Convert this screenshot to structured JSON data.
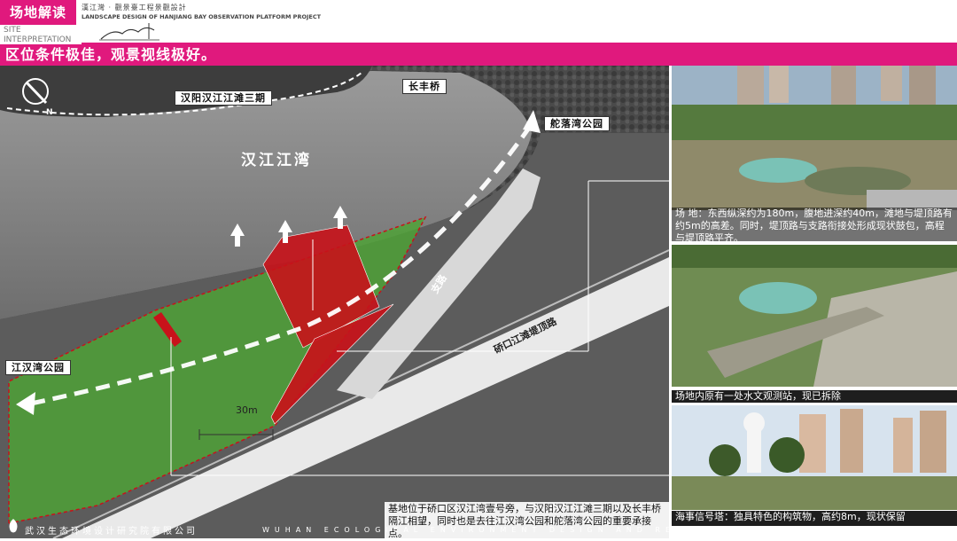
{
  "header": {
    "badge": "场地解读",
    "badge_sub": "SITE\nINTERPRETATION",
    "project_cn": "漢江灣 · 觀景臺工程景觀設計",
    "project_en": "LANDSCAPE DESIGN OF HANJIANG BAY OBSERVATION PLATFORM PROJECT"
  },
  "title": "区位条件极佳，观景视线极好。",
  "map": {
    "labels": {
      "hanyang": "汉阳汉江江滩三期",
      "changfeng": "长丰桥",
      "tuoluowan": "舵落湾公园",
      "hanjiang_bay": "汉江江湾",
      "hanjiangwan_park": "江汉湾公园",
      "branch_road": "支路",
      "levee_road": "硚口江滩堤顶路",
      "dim": "30m",
      "north": "N"
    },
    "note": "基地位于硚口区汉江湾壹号旁，与汉阳汉江江滩三期以及长丰桥隔江相望，同时也是去往江汉湾公园和舵落湾公园的重要承接点。"
  },
  "footer": {
    "company_cn": "武汉生态环境设计研究院有限公司",
    "company_en": "WUHAN ECOLOGICAL ENVIRONMENT DESIGN AND RESEARCH INSTITUTE CO., LTD"
  },
  "photos": [
    {
      "caption": "场 地：东西纵深约为180m，腹地进深约40m，滩地与堤顶路有约5m的高差。同时，堤顶路与支路衔接处形成现状鼓包，高程与堤顶路平齐。"
    },
    {
      "caption": "场地内原有一处水文观测站，现已拆除"
    },
    {
      "caption": "海事信号塔：独具特色的构筑物，高约8m，现状保留"
    }
  ],
  "colors": {
    "accent": "#e0197d",
    "site_green": "#4ea336",
    "site_red": "#c8121a",
    "water": "#8a8a8a"
  }
}
